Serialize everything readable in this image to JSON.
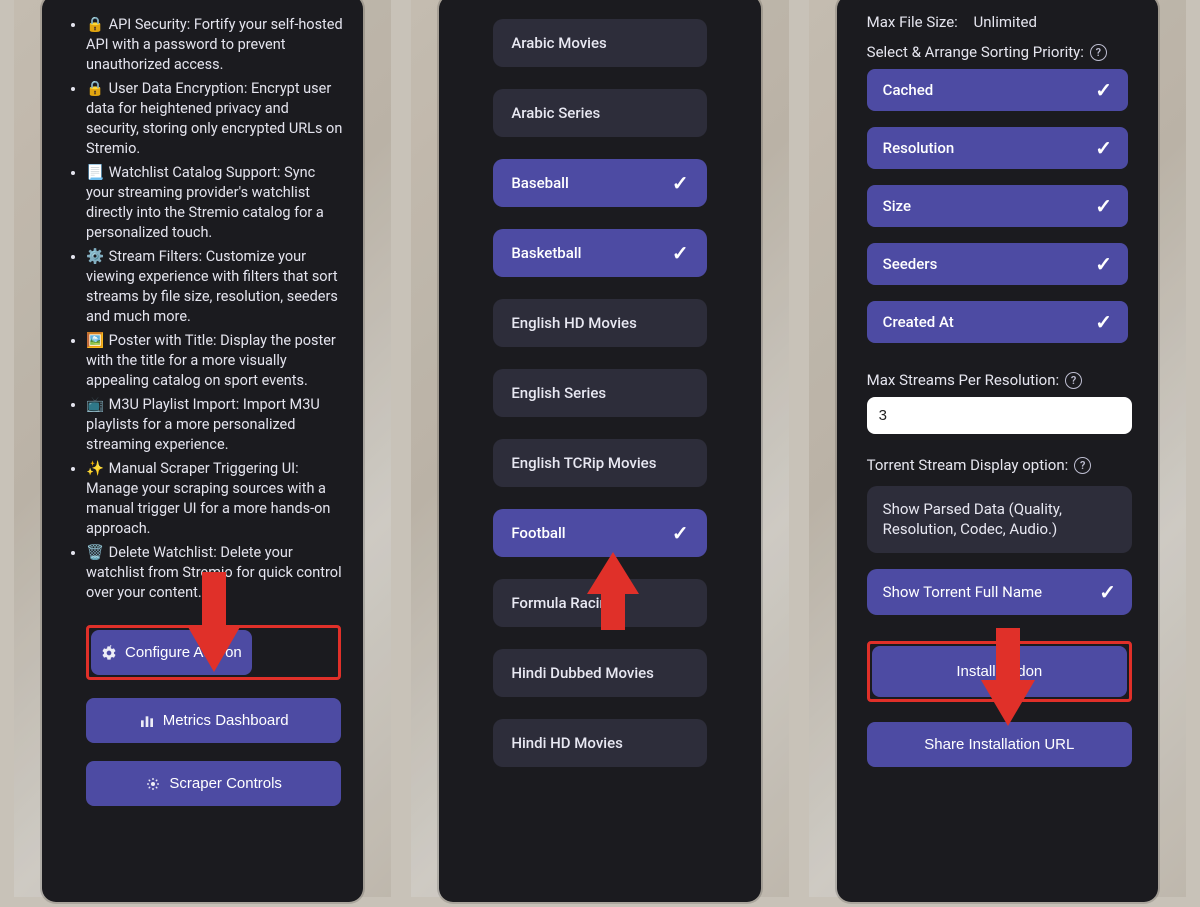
{
  "colors": {
    "accent": "#4d4ba3",
    "chip_bg": "#2d2d3a",
    "panel_bg": "#1b1b1f",
    "highlight": "#e03029"
  },
  "panel1": {
    "features": [
      {
        "icon": "🔒",
        "title": "API Security:",
        "desc": "Fortify your self-hosted API with a password to prevent unauthorized access."
      },
      {
        "icon": "🔒",
        "title": "User Data Encryption:",
        "desc": "Encrypt user data for heightened privacy and security, storing only encrypted URLs on Stremio."
      },
      {
        "icon": "📃",
        "title": "Watchlist Catalog Support:",
        "desc": "Sync your streaming provider's watchlist directly into the Stremio catalog for a personalized touch."
      },
      {
        "icon": "⚙️",
        "title": "Stream Filters:",
        "desc": "Customize your viewing experience with filters that sort streams by file size, resolution, seeders and much more."
      },
      {
        "icon": "🖼️",
        "title": "Poster with Title:",
        "desc": "Display the poster with the title for a more visually appealing catalog on sport events."
      },
      {
        "icon": "📺",
        "title": "M3U Playlist Import:",
        "desc": "Import M3U playlists for a more personalized streaming experience."
      },
      {
        "icon": "✨",
        "title": "Manual Scraper Triggering UI:",
        "desc": "Manage your scraping sources with a manual trigger UI for a more hands-on approach."
      },
      {
        "icon": "🗑️",
        "title": "Delete Watchlist:",
        "desc": "Delete your watchlist from Stremio for quick control over your content."
      }
    ],
    "buttons": {
      "configure": "Configure Add-on",
      "metrics": "Metrics Dashboard",
      "scraper": "Scraper Controls"
    }
  },
  "panel2": {
    "items": [
      {
        "label": "Arabic Movies",
        "selected": false
      },
      {
        "label": "Arabic Series",
        "selected": false
      },
      {
        "label": "Baseball",
        "selected": true
      },
      {
        "label": "Basketball",
        "selected": true
      },
      {
        "label": "English HD Movies",
        "selected": false
      },
      {
        "label": "English Series",
        "selected": false
      },
      {
        "label": "English TCRip Movies",
        "selected": false
      },
      {
        "label": "Football",
        "selected": true
      },
      {
        "label": "Formula Racing",
        "selected": false
      },
      {
        "label": "Hindi Dubbed Movies",
        "selected": false
      },
      {
        "label": "Hindi HD Movies",
        "selected": false
      }
    ]
  },
  "panel3": {
    "max_file_size_label": "Max File Size:",
    "max_file_size_value": "Unlimited",
    "sort_label": "Select & Arrange Sorting Priority:",
    "sort_items": [
      {
        "label": "Cached"
      },
      {
        "label": "Resolution"
      },
      {
        "label": "Size"
      },
      {
        "label": "Seeders"
      },
      {
        "label": "Created At"
      }
    ],
    "max_streams_label": "Max Streams Per Resolution:",
    "max_streams_value": "3",
    "display_label": "Torrent Stream Display option:",
    "display_options": [
      {
        "label": "Show Parsed Data (Quality, Resolution, Codec, Audio.)",
        "selected": false
      },
      {
        "label": "Show Torrent Full Name",
        "selected": true
      }
    ],
    "actions": {
      "install": "Install Addon",
      "share": "Share Installation URL"
    }
  }
}
